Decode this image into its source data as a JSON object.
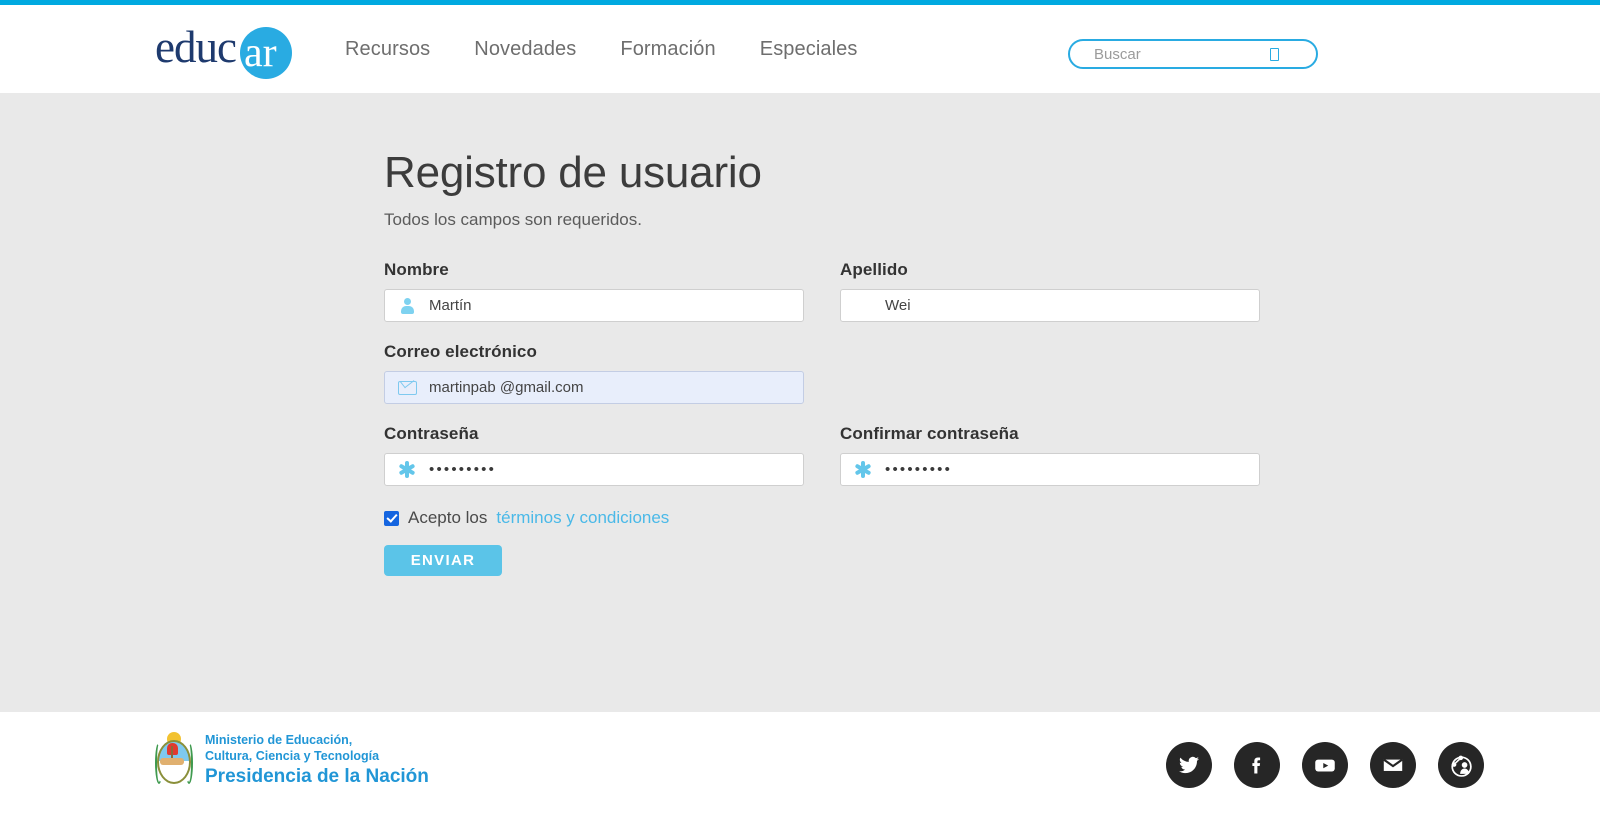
{
  "theme": {
    "accent": "#29abe2",
    "accent_button": "#5bc4e8",
    "link": "#4ab9e8",
    "page_bg": "#e9e9e9",
    "gov_blue": "#2196d6"
  },
  "header": {
    "logo": {
      "text": "educ",
      "badge": "ar",
      "name": "educar"
    },
    "nav": [
      {
        "label": "Recursos"
      },
      {
        "label": "Novedades"
      },
      {
        "label": "Formación"
      },
      {
        "label": "Especiales"
      }
    ],
    "search": {
      "placeholder": "Buscar",
      "value": "",
      "icon": "search-icon"
    }
  },
  "main": {
    "title": "Registro de usuario",
    "subtitle": "Todos los campos son requeridos.",
    "fields": {
      "nombre": {
        "label": "Nombre",
        "value": "Martín",
        "icon": "person-icon"
      },
      "apellido": {
        "label": "Apellido",
        "value": "Wei",
        "icon": ""
      },
      "correo": {
        "label": "Correo electrónico",
        "value": "martinpab @gmail.com",
        "icon": "envelope-icon"
      },
      "password": {
        "label": "Contraseña",
        "value": "•••••••••",
        "icon": "asterisk-icon"
      },
      "password_confirm": {
        "label": "Confirmar contraseña",
        "value": "•••••••••",
        "icon": "asterisk-icon"
      }
    },
    "terms": {
      "checked": true,
      "text": "Acepto los",
      "link_text": "términos y condiciones"
    },
    "submit_label": "ENVIAR"
  },
  "footer": {
    "gov": {
      "line1": "Ministerio de Educación,",
      "line2": "Cultura, Ciencia y Tecnología",
      "line3": "Presidencia de la Nación",
      "emblem": "argentina-coat-of-arms"
    },
    "socials": [
      {
        "name": "twitter-icon"
      },
      {
        "name": "facebook-icon"
      },
      {
        "name": "youtube-icon"
      },
      {
        "name": "email-icon"
      },
      {
        "name": "share-network-icon"
      }
    ]
  }
}
